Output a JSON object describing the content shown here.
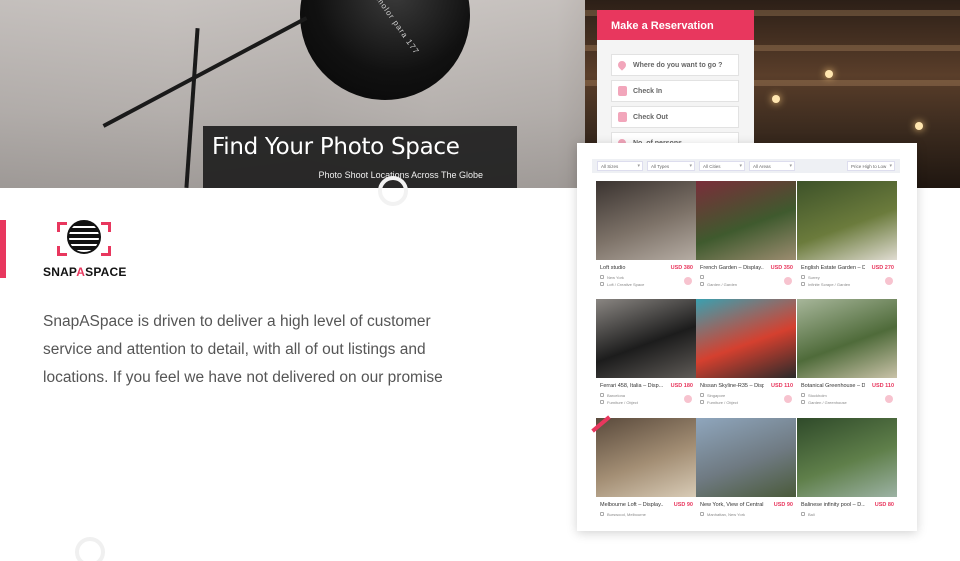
{
  "hero": {
    "title": "Find Your Photo Space",
    "subtitle": "Photo Shoot Locations Across The Globe",
    "umbrella_text": "brotmolor para 177"
  },
  "reservation": {
    "title": "Make a Reservation",
    "destination_placeholder": "Where do you want to go ?",
    "check_in_placeholder": "Check In",
    "check_out_placeholder": "Check Out",
    "persons_placeholder": "No. of persons"
  },
  "brand": {
    "name_part1": "SNAP",
    "name_part2": "A",
    "name_part3": "SPACE",
    "description": "SnapASpace is driven to deliver a high level of customer service and attention to detail, with all of out listings and locations. If you feel we have not delivered on our promise"
  },
  "listings": {
    "filters": [
      "All Sizes",
      "All Types",
      "All Cities",
      "All Areas",
      "Price High to Low"
    ],
    "items": [
      {
        "name": "Loft studio",
        "price": "USD 380",
        "location": "New York",
        "category": "Loft / Creative Space",
        "photo_colors": [
          "#3a3330",
          "#7d7268",
          "#b5aca3"
        ]
      },
      {
        "name": "French Garden – Display...",
        "price": "USD 350",
        "location": "",
        "category": "Garden / Garden",
        "photo_colors": [
          "#7a2d3a",
          "#3f5a2e",
          "#9c8c70"
        ]
      },
      {
        "name": "English Estate Garden – Di...",
        "price": "USD 270",
        "location": "Surrey",
        "category": "Infinite Scrape / Garden",
        "photo_colors": [
          "#3d5229",
          "#6b7b3c",
          "#e0dcd2"
        ]
      },
      {
        "name": "Ferrari 458, Italia – Disp...",
        "price": "USD 180",
        "location": "Barcelona",
        "category": "Furniture / Object",
        "photo_colors": [
          "#8a8682",
          "#1c1c1c",
          "#5f5b57"
        ]
      },
      {
        "name": "Nissan Skyline-R35 – Displ...",
        "price": "USD 110",
        "location": "Singapore",
        "category": "Furniture / Object",
        "photo_colors": [
          "#3aa0b0",
          "#d5402f",
          "#2a2a2a"
        ]
      },
      {
        "name": "Botanical Greenhouse – Dis...",
        "price": "USD 110",
        "location": "Stockholm",
        "category": "Garden / Greenhouse",
        "photo_colors": [
          "#a7b69a",
          "#4f6b3a",
          "#c9c2a8"
        ]
      },
      {
        "name": "Melbourne Loft – Display...",
        "price": "USD 90",
        "location": "Burswood, Melbourne",
        "category": "",
        "photo_colors": [
          "#5a4a3c",
          "#a38e74",
          "#d8cbb6"
        ]
      },
      {
        "name": "New York, View of Central ...",
        "price": "USD 90",
        "location": "Manhattan, New York",
        "category": "",
        "photo_colors": [
          "#8fa6bd",
          "#6f7a82",
          "#4a5a3a"
        ]
      },
      {
        "name": "Balinese infinity pool – D...",
        "price": "USD 80",
        "location": "Bali",
        "category": "",
        "photo_colors": [
          "#2f4a2a",
          "#5f7f4a",
          "#9cb2a4"
        ]
      }
    ]
  },
  "colors": {
    "accent": "#e8375e",
    "text": "#555555",
    "dark_box": "#1e1e1e"
  }
}
